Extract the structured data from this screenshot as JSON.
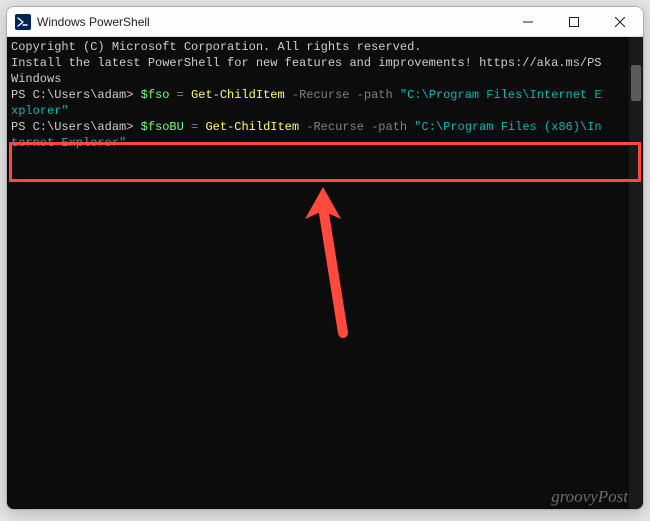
{
  "window": {
    "title": "Windows PowerShell"
  },
  "terminal": {
    "line1": "Copyright (C) Microsoft Corporation. All rights reserved.",
    "blank": "",
    "line2a": "Install the latest PowerShell for new features and improvements! https://aka.ms/PS",
    "line2b": "Windows",
    "prompt1_prefix": "PS C:\\Users\\adam> ",
    "prompt1_var": "$fso",
    "prompt1_eq": " = ",
    "prompt1_cmd": "Get-ChildItem",
    "prompt1_flags": " -Recurse -path ",
    "prompt1_str_a": "\"C:\\Program Files\\Internet E",
    "prompt1_str_b": "xplorer\"",
    "prompt2_prefix": "PS C:\\Users\\adam> ",
    "prompt2_var": "$fsoBU",
    "prompt2_eq": " = ",
    "prompt2_cmd": "Get-ChildItem",
    "prompt2_flags": " -Recurse -path ",
    "prompt2_str_a": "\"C:\\Program Files (x86)\\In",
    "prompt2_str_b": "ternet Explorer\""
  },
  "watermark": "groovyPost"
}
